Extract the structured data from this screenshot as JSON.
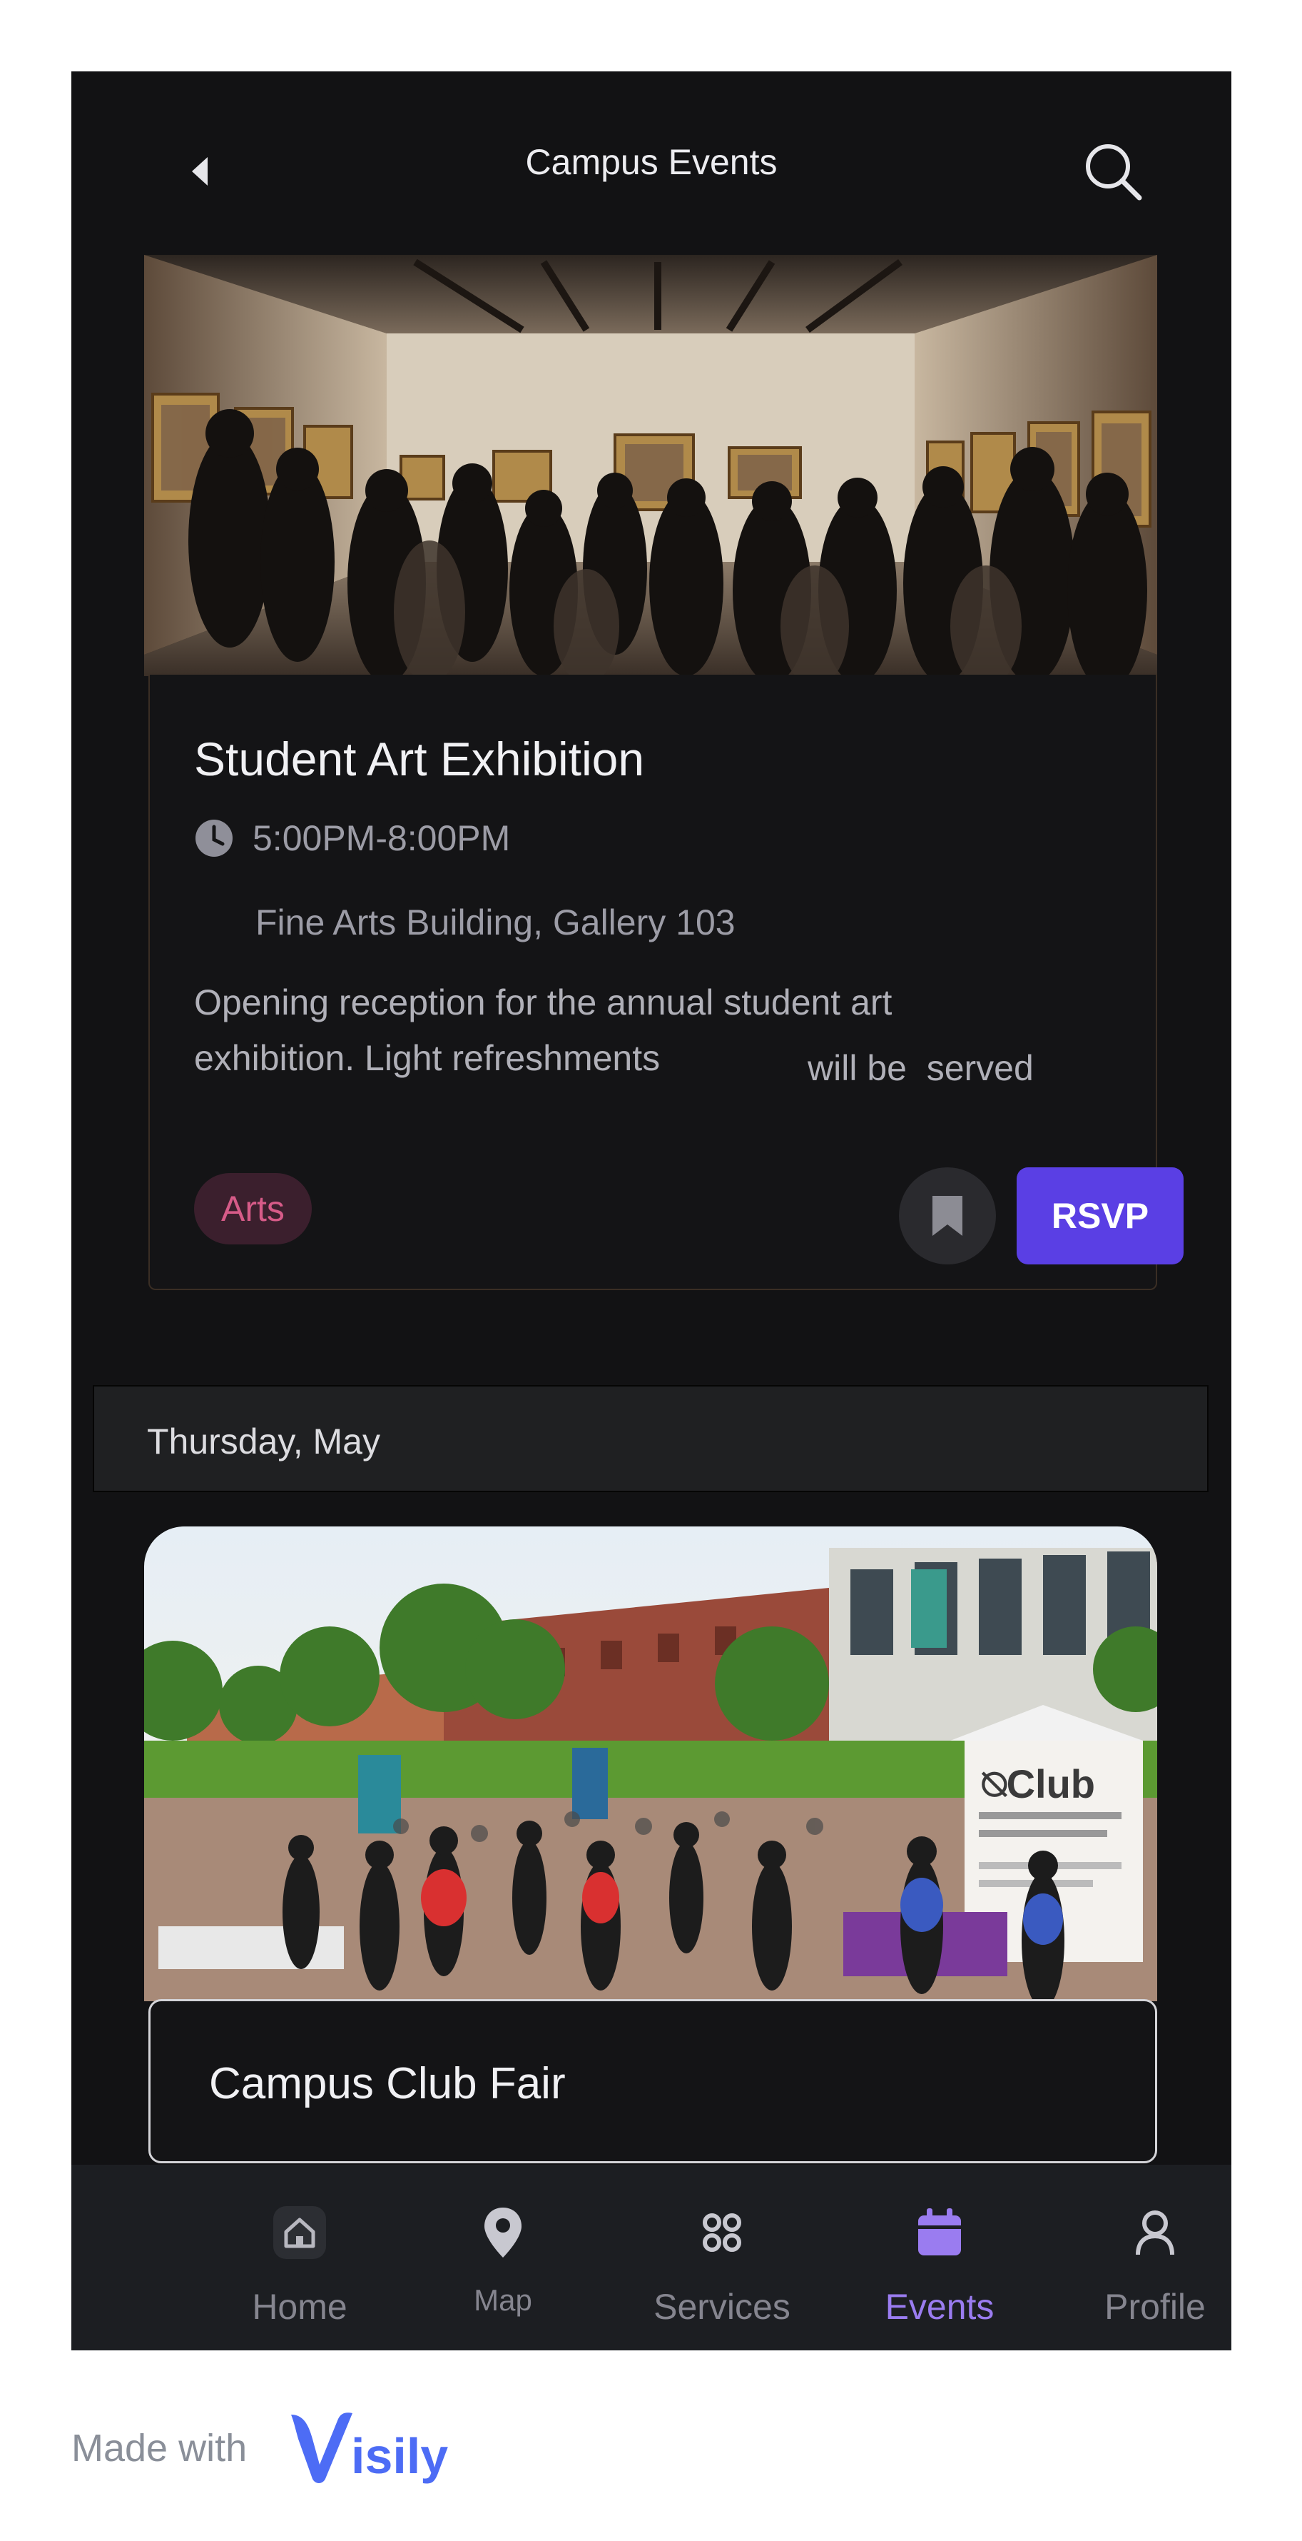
{
  "header": {
    "title": "Campus Events",
    "back_icon": "back-arrow-icon",
    "search_icon": "search-icon"
  },
  "events": [
    {
      "title": "Student Art Exhibition",
      "time": "5:00PM-8:00PM",
      "location": "Fine Arts Building, Gallery 103",
      "description_line1": "Opening reception for the annual student art",
      "description_line2": "exhibition. Light refreshments",
      "description_line2b": "will be  served",
      "tag": "Arts",
      "rsvp_label": "RSVP"
    }
  ],
  "date_header": "Thursday, May",
  "event2": {
    "title": "Campus Club Fair",
    "banner_text": "Club"
  },
  "nav": {
    "items": [
      {
        "label": "Home",
        "icon": "home-icon"
      },
      {
        "label": "Map",
        "icon": "map-pin-icon"
      },
      {
        "label": "Services",
        "icon": "services-grid-icon"
      },
      {
        "label": "Events",
        "icon": "calendar-icon",
        "active": true
      },
      {
        "label": "Profile",
        "icon": "profile-icon"
      }
    ]
  },
  "footer": {
    "made_with": "Made with",
    "brand": "Visily"
  },
  "colors": {
    "background": "#121214",
    "accent": "#5a3fe4",
    "active_nav": "#9a7cf0",
    "tag_text": "#d65b88",
    "tag_bg": "#3b1f2d",
    "brand_blue": "#4d6cf5"
  }
}
